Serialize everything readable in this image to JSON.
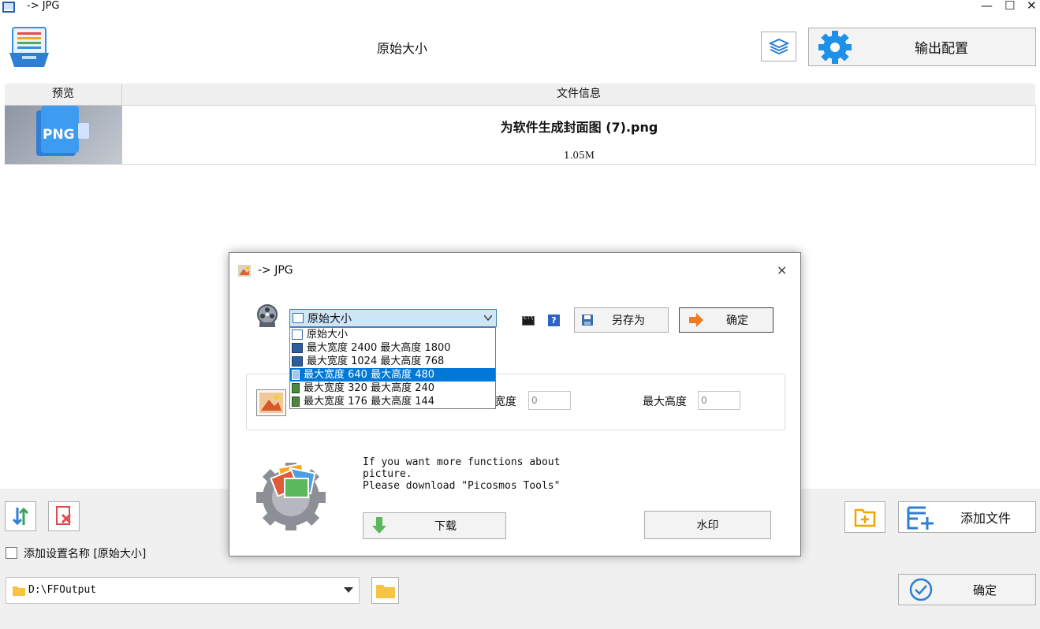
{
  "window": {
    "title": "-> JPG",
    "controls": {
      "minimize": "—",
      "maximize": "☐",
      "close": "✕"
    }
  },
  "header": {
    "preset_title": "原始大小",
    "output_config_label": "输出配置"
  },
  "table": {
    "columns": [
      "预览",
      "文件信息"
    ],
    "rows": [
      {
        "thumb_label": "PNG",
        "name": "为软件生成封面图 (7).png",
        "size": "1.05M"
      }
    ]
  },
  "footer": {
    "add_name_label": "添加设置名称 [原始大小]",
    "add_name_checked": false,
    "output_path": "D:\\FFOutput",
    "add_file_label": "添加文件",
    "confirm_label": "确定"
  },
  "dialog": {
    "title": "-> JPG",
    "close": "×",
    "preset_select_value": "原始大小",
    "save_as_label": "另存为",
    "ok_label": "确定",
    "preset_options": [
      {
        "label": "原始大小",
        "selected": false
      },
      {
        "label": "最大宽度 2400 最大高度 1800",
        "selected": false
      },
      {
        "label": "最大宽度 1024 最大高度 768",
        "selected": false
      },
      {
        "label": "最大宽度 640 最大高度 480",
        "selected": true
      },
      {
        "label": "最大宽度 320 最大高度 240",
        "selected": false
      },
      {
        "label": "最大宽度 176 最大高度 144",
        "selected": false
      }
    ],
    "width_label_partial": "宽度",
    "width_value": "0",
    "max_height_label": "最大高度",
    "max_height_value": "0",
    "promo_text_1": "If you want more functions about",
    "promo_text_2": "picture.",
    "promo_text_3": "Please download \"Picosmos Tools\"",
    "download_label": "下载",
    "watermark_label": "水印"
  },
  "colors": {
    "accent_blue": "#0078d7",
    "gear_blue": "#1e90e8",
    "folder_yellow": "#f6c343",
    "delete_red": "#e04a4a"
  }
}
